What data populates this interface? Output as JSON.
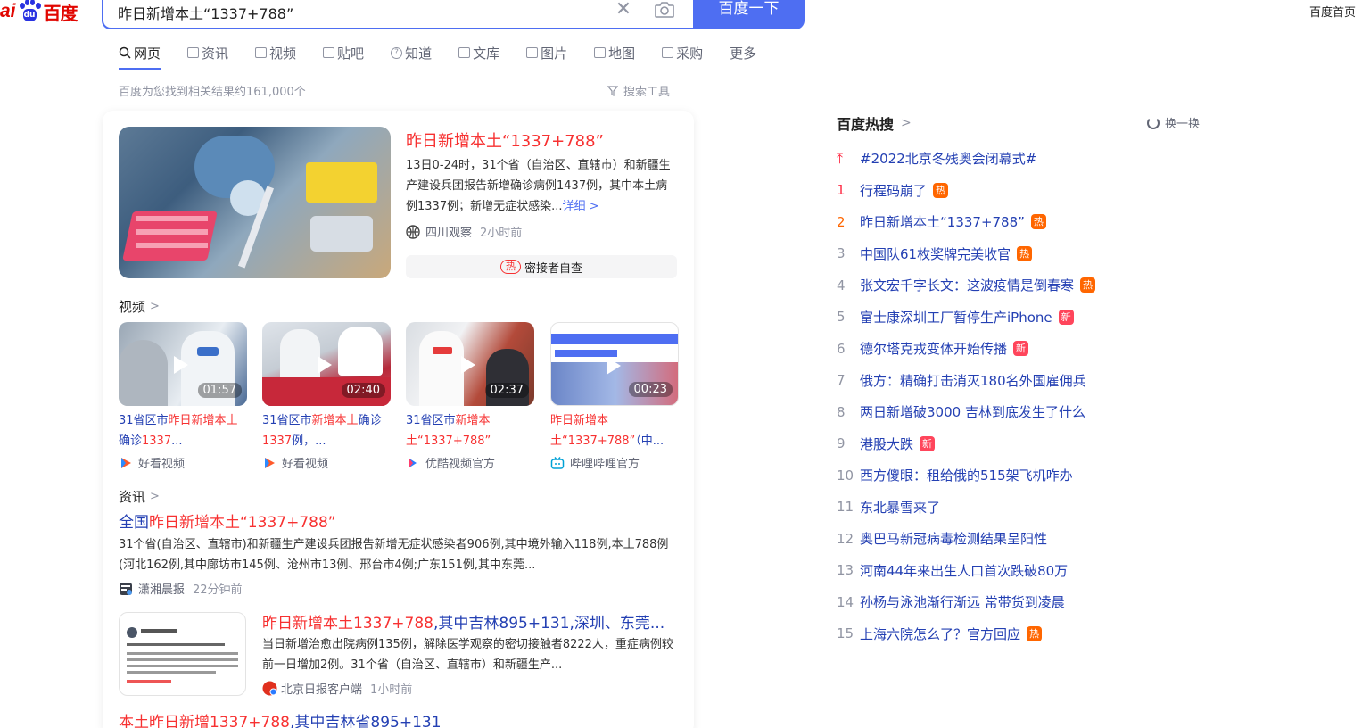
{
  "header": {
    "logo_ai": "ai",
    "logo_paw_glyph": "du",
    "logo_cn": "百度",
    "search_value": "昨日新增本土“1337+788”",
    "search_button": "百度一下",
    "home_link": "百度首页"
  },
  "tabs": [
    {
      "label": "网页",
      "icon": "search-icon"
    },
    {
      "label": "资讯",
      "icon": "news-icon"
    },
    {
      "label": "视频",
      "icon": "video-icon"
    },
    {
      "label": "贴吧",
      "icon": "tieba-icon"
    },
    {
      "label": "知道",
      "icon": "question-icon"
    },
    {
      "label": "文库",
      "icon": "document-icon"
    },
    {
      "label": "图片",
      "icon": "image-icon"
    },
    {
      "label": "地图",
      "icon": "map-icon"
    },
    {
      "label": "采购",
      "icon": "shopping-icon"
    },
    {
      "label": "更多",
      "icon": ""
    }
  ],
  "result_count": "百度为您找到相关结果约161,000个",
  "search_tools": "搜索工具",
  "top_result": {
    "title": "昨日新增本土“1337+788”",
    "desc": "13日0-24时，31个省（自治区、直辖市）和新疆生产建设兵团报告新增确诊病例1437例，其中本土病例1337例；新增无症状感染...",
    "more": "详细 >",
    "source": "四川观察",
    "time": "2小时前",
    "tag_chip": "热",
    "tag_text": "密接者自查"
  },
  "video_section": {
    "label": "视频"
  },
  "videos": [
    {
      "t1": "31省区市",
      "t2": "昨日新增本土",
      "t3": "确诊",
      "t4": "1337",
      "t5": "...",
      "duration": "01:57",
      "source": "好看视频"
    },
    {
      "t1": "31省区市",
      "t2": "新增本土",
      "t3": "确诊",
      "t4": "1337",
      "t5": "例，...",
      "duration": "02:40",
      "source": "好看视频"
    },
    {
      "t1": "31省区市",
      "t2": "新增本土“1337+788”",
      "t3": "",
      "t4": "",
      "t5": "",
      "duration": "02:37",
      "source": "优酷视频官方"
    },
    {
      "t1": "",
      "t2": "昨日新增本土“1337+788”",
      "t3": "（中...",
      "t4": "",
      "t5": "",
      "duration": "00:23",
      "source": "哔哩哔哩官方"
    }
  ],
  "news_section": {
    "label": "资讯"
  },
  "news1": {
    "pre": "全国",
    "hl": "昨日新增本土“1337+788”",
    "desc": "31个省(自治区、直辖市)和新疆生产建设兵团报告新增无症状感染者906例,其中境外输入118例,本土788例(河北162例,其中廊坊市145例、沧州市13例、邢台市4例;广东151例,其中东莞...",
    "source": "潇湘晨报",
    "time": "22分钟前"
  },
  "news2": {
    "hl": "昨日新增本土1337+788",
    "rest": ",其中吉林895+131,深圳、东莞...",
    "desc": "当日新增治愈出院病例135例，解除医学观察的密切接触者8222人，重症病例较前一日增加2例。31个省（自治区、直辖市）和新疆生产...",
    "source": "北京日报客户端",
    "time": "1小时前"
  },
  "news3": {
    "hl1": "本土",
    "hl2": "昨日新增1337+788",
    "rest": ",其中吉林省895+131"
  },
  "hot": {
    "title": "百度热搜",
    "refresh": "换一换",
    "items": [
      {
        "rank": "",
        "text": "#2022北京冬残奥会闭幕式#",
        "badge": ""
      },
      {
        "rank": "1",
        "text": "行程码崩了",
        "badge": "热"
      },
      {
        "rank": "2",
        "text": "昨日新增本土“1337+788”",
        "badge": "热"
      },
      {
        "rank": "3",
        "text": "中国队61枚奖牌完美收官",
        "badge": "热"
      },
      {
        "rank": "4",
        "text": "张文宏千字长文：这波疫情是倒春寒",
        "badge": "热"
      },
      {
        "rank": "5",
        "text": "富士康深圳工厂暂停生产iPhone",
        "badge": "新"
      },
      {
        "rank": "6",
        "text": "德尔塔克戎变体开始传播",
        "badge": "新"
      },
      {
        "rank": "7",
        "text": "俄方：精确打击消灭180名外国雇佣兵",
        "badge": ""
      },
      {
        "rank": "8",
        "text": "两日新增破3000 吉林到底发生了什么",
        "badge": ""
      },
      {
        "rank": "9",
        "text": "港股大跌",
        "badge": "新"
      },
      {
        "rank": "10",
        "text": "西方傻眼：租给俄的515架飞机咋办",
        "badge": ""
      },
      {
        "rank": "11",
        "text": "东北暴雪来了",
        "badge": ""
      },
      {
        "rank": "12",
        "text": "奥巴马新冠病毒检测结果呈阳性",
        "badge": ""
      },
      {
        "rank": "13",
        "text": "河南44年来出生人口首次跌破80万",
        "badge": ""
      },
      {
        "rank": "14",
        "text": "孙杨与泳池渐行渐远 常带货到凌晨",
        "badge": ""
      },
      {
        "rank": "15",
        "text": "上海六院怎么了？官方回应",
        "badge": "热"
      }
    ]
  },
  "colors": {
    "brand_blue": "#4e6ef2",
    "link_blue": "#2440b3",
    "highlight_red": "#f73131",
    "hot_orange": "#ff6600",
    "new_red": "#ff455b"
  }
}
